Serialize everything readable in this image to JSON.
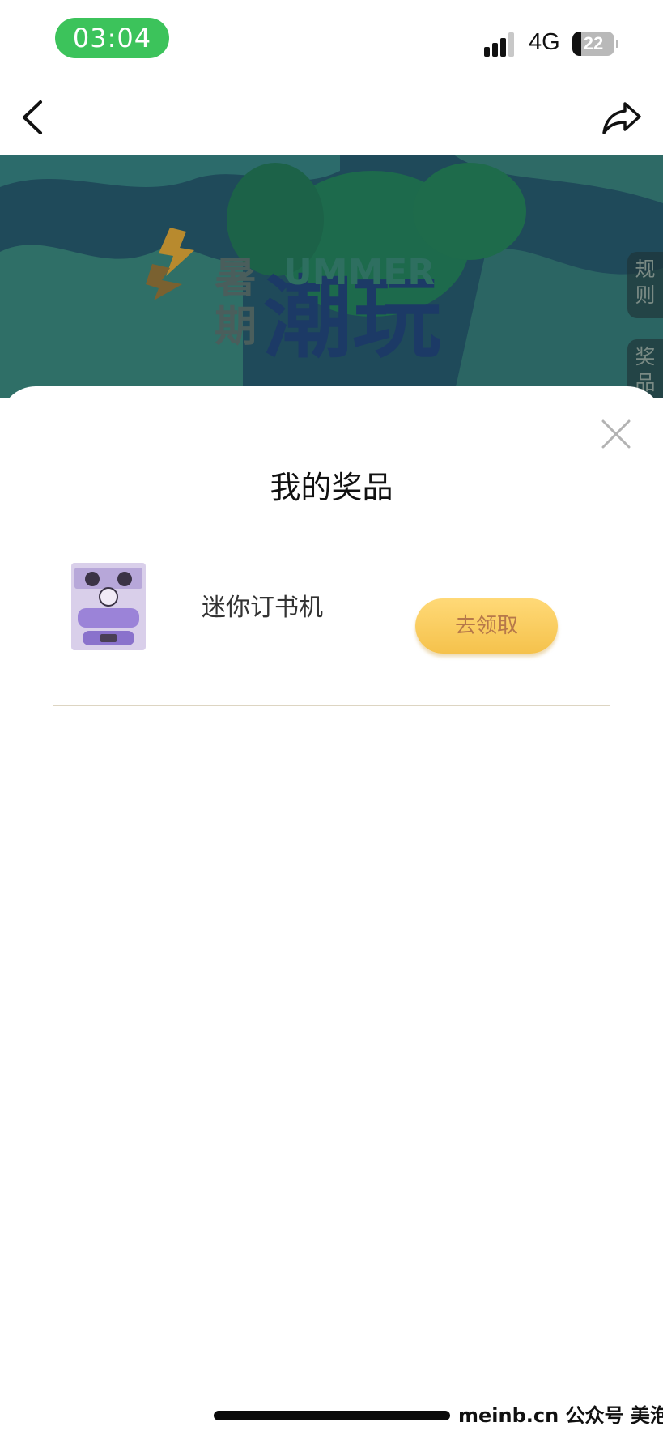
{
  "status_bar": {
    "time": "03:04",
    "network": "4G",
    "battery_level": "22"
  },
  "nav": {
    "back_icon": "chevron-left-icon",
    "share_icon": "share-arrow-icon"
  },
  "banner": {
    "side_tabs": [
      {
        "label": "规则"
      },
      {
        "label": "奖品"
      }
    ]
  },
  "sheet": {
    "title": "我的奖品",
    "close_icon": "close-icon",
    "prizes": [
      {
        "name": "迷你订书机",
        "action_label": "去领取"
      }
    ]
  },
  "footer": {
    "watermark": "meinb.cn  公众号 美泡君"
  },
  "colors": {
    "time_pill": "#3cc35b",
    "claim_button": "#f7c75a",
    "claim_text": "#b6784a",
    "divider": "#ddd5c2"
  }
}
